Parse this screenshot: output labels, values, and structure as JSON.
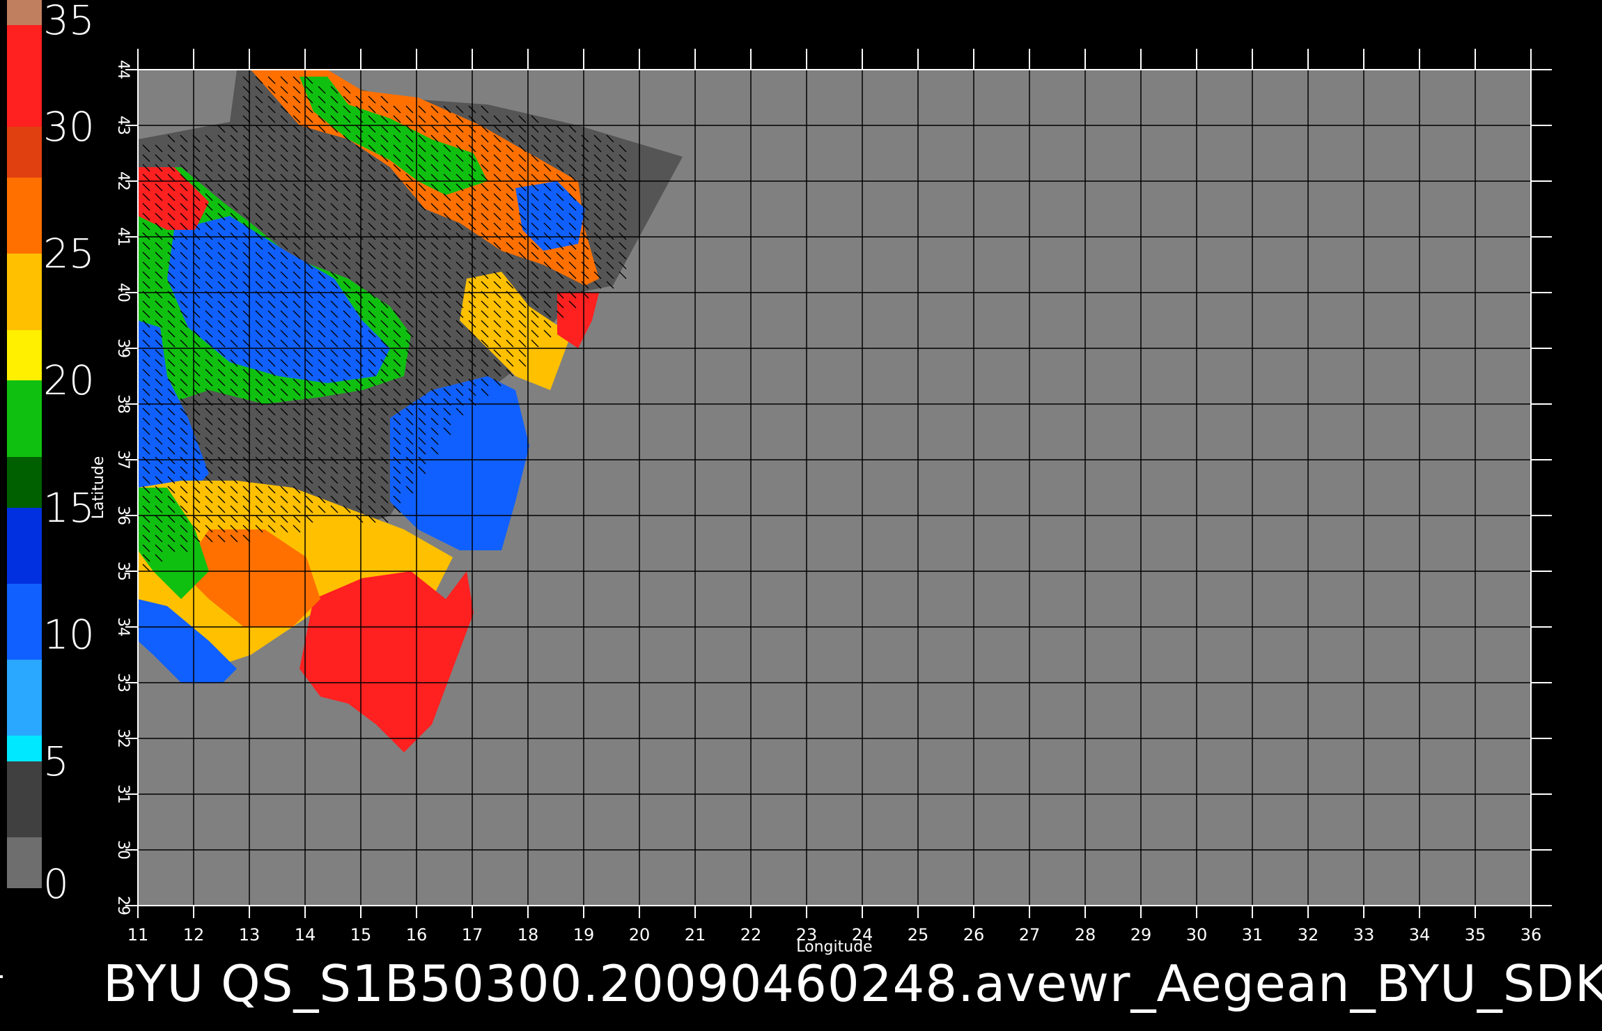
{
  "title": "BYU  QS_S1B50300.20090460248.avewr_Aegean_BYU_SDK",
  "axes": {
    "xlabel": "Longitude",
    "ylabel": "Latitude",
    "x_ticks": [
      "11",
      "12",
      "13",
      "14",
      "15",
      "16",
      "17",
      "18",
      "19",
      "20",
      "21",
      "22",
      "23",
      "24",
      "25",
      "26",
      "27",
      "28",
      "29",
      "30",
      "31",
      "32",
      "33",
      "34",
      "35",
      "36"
    ],
    "y_ticks": [
      "29",
      "30",
      "31",
      "32",
      "33",
      "34",
      "35",
      "36",
      "37",
      "38",
      "39",
      "40",
      "41",
      "42",
      "43",
      "44"
    ]
  },
  "colorbar": {
    "labels": [
      "35",
      "30",
      "25",
      "20",
      "15",
      "10",
      "5",
      "0"
    ],
    "segments": [
      {
        "from": 0,
        "to": 2,
        "color": "#6e6e6e"
      },
      {
        "from": 2,
        "to": 5,
        "color": "#404040"
      },
      {
        "from": 5,
        "to": 6,
        "color": "#00e8ff"
      },
      {
        "from": 6,
        "to": 9,
        "color": "#2aa8ff"
      },
      {
        "from": 9,
        "to": 12,
        "color": "#1060ff"
      },
      {
        "from": 12,
        "to": 15,
        "color": "#0030e0"
      },
      {
        "from": 15,
        "to": 17,
        "color": "#006000"
      },
      {
        "from": 17,
        "to": 20,
        "color": "#10c010"
      },
      {
        "from": 20,
        "to": 22,
        "color": "#fff000"
      },
      {
        "from": 22,
        "to": 25,
        "color": "#ffc000"
      },
      {
        "from": 25,
        "to": 28,
        "color": "#ff7000"
      },
      {
        "from": 28,
        "to": 30,
        "color": "#e04010"
      },
      {
        "from": 30,
        "to": 34,
        "color": "#ff2020"
      },
      {
        "from": 34,
        "to": 35,
        "color": "#c08060"
      }
    ]
  },
  "map": {
    "background_color": "#808080",
    "land_color": "#555555",
    "grid_color": "#000000",
    "lon_range": [
      11,
      36
    ],
    "lat_range": [
      29,
      44
    ],
    "swath": [
      {
        "region": "north-adriatic-red",
        "color": "#ff7000"
      },
      {
        "region": "southwest-red",
        "color": "#ff2020"
      },
      {
        "region": "aegean-blue",
        "color": "#1060ff"
      }
    ]
  }
}
